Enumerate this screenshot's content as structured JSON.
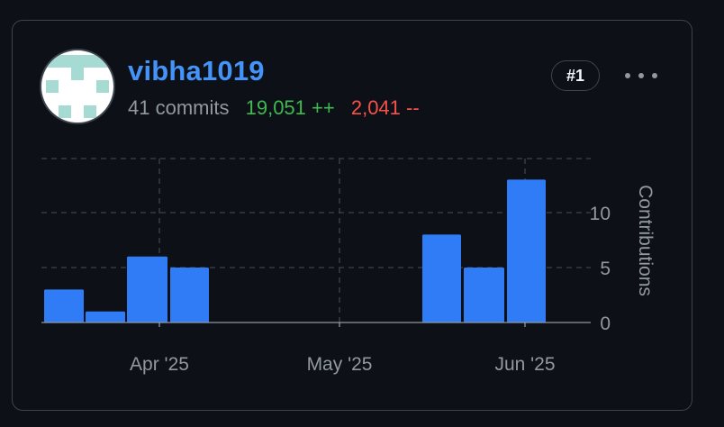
{
  "contributor": {
    "username": "vibha1019",
    "commits_text": "41 commits",
    "additions_text": "19,051 ++",
    "deletions_text": "2,041 --",
    "rank_badge": "#1",
    "more_icon": "kebab-horizontal-icon"
  },
  "colors": {
    "background": "#0d1117",
    "border": "#3d444d",
    "username": "#4493f8",
    "additions": "#3fb950",
    "deletions": "#f85149",
    "bar": "#2f7cf6",
    "muted_text": "#9198a1",
    "avatar_pattern": "#a6dbd3"
  },
  "chart_data": {
    "type": "bar",
    "ylabel": "Contributions",
    "ylim": [
      0,
      15
    ],
    "yticks": [
      0,
      5,
      10
    ],
    "x_tick_labels": [
      "Apr '25",
      "May '25",
      "Jun '25"
    ],
    "bars": [
      {
        "week": 1,
        "value": 3
      },
      {
        "week": 2,
        "value": 1
      },
      {
        "week": 3,
        "value": 6
      },
      {
        "week": 4,
        "value": 5
      },
      {
        "week": 13,
        "value": 8
      },
      {
        "week": 14,
        "value": 5
      },
      {
        "week": 15,
        "value": 13
      }
    ],
    "grid": true,
    "legend": "none"
  }
}
